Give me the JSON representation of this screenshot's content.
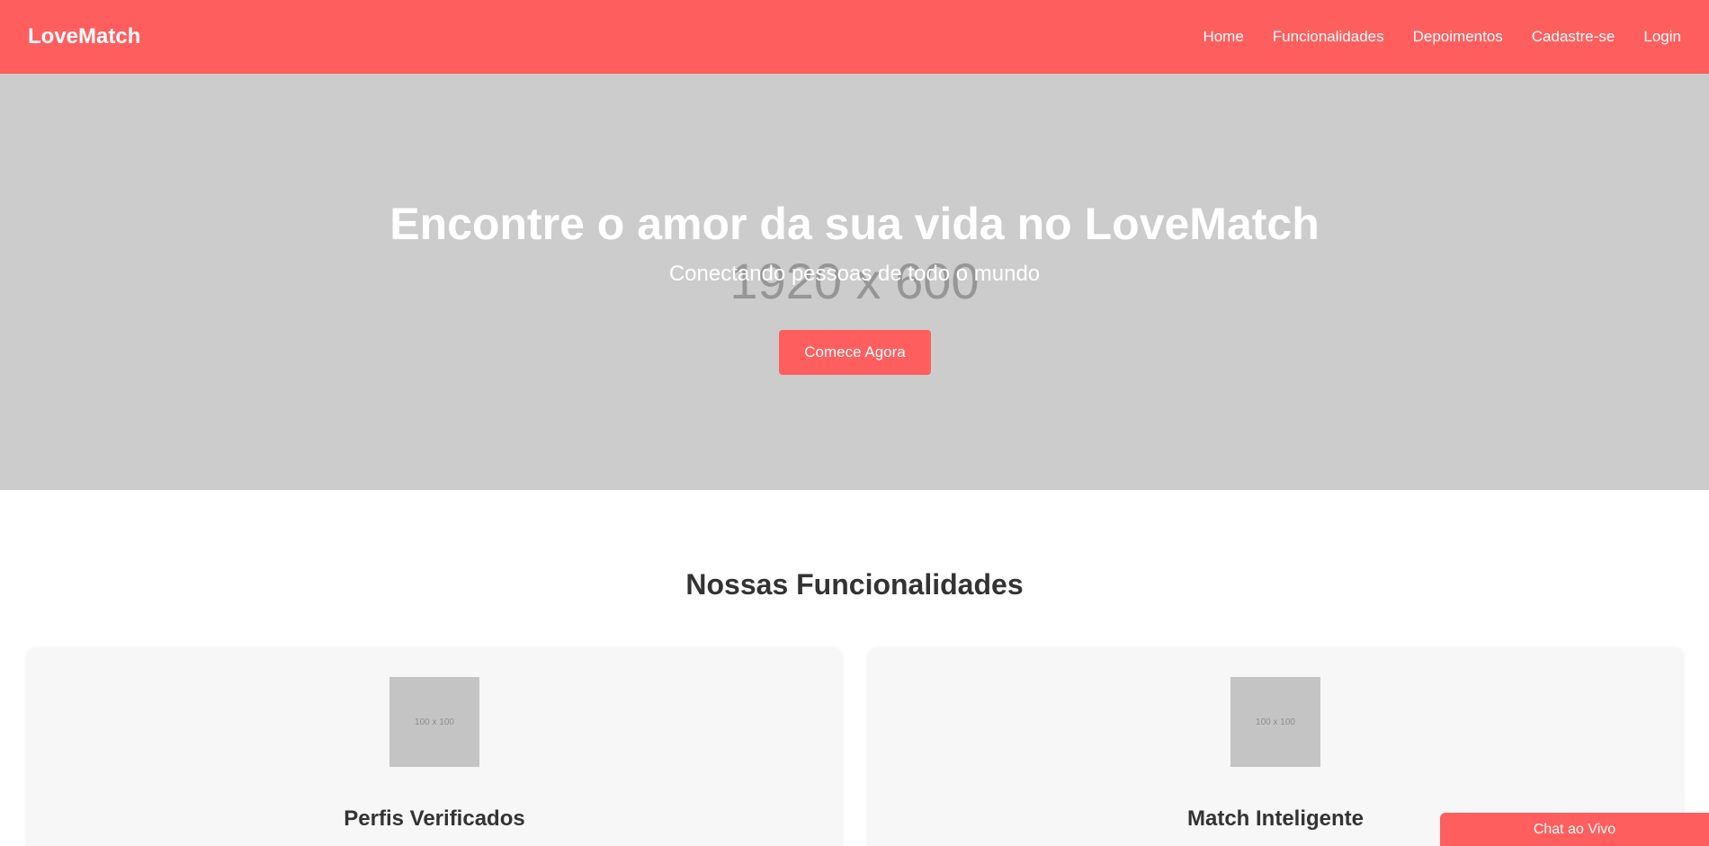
{
  "header": {
    "logo": "LoveMatch",
    "nav": [
      "Home",
      "Funcionalidades",
      "Depoimentos",
      "Cadastre-se",
      "Login"
    ]
  },
  "hero": {
    "placeholder_text": "1920 x 600",
    "title": "Encontre o amor da sua vida no LoveMatch",
    "subtitle": "Conectando pessoas de todo o mundo",
    "cta_label": "Comece Agora"
  },
  "features": {
    "section_title": "Nossas Funcionalidades",
    "items": [
      {
        "image_placeholder": "100 x 100",
        "title": "Perfis Verificados"
      },
      {
        "image_placeholder": "100 x 100",
        "title": "Match Inteligente"
      }
    ]
  },
  "chat": {
    "label": "Chat ao Vivo"
  },
  "colors": {
    "brand": "#ff5e5e",
    "hero_bg": "#cccccc",
    "card_bg": "#f7f7f7",
    "text_dark": "#333333"
  }
}
